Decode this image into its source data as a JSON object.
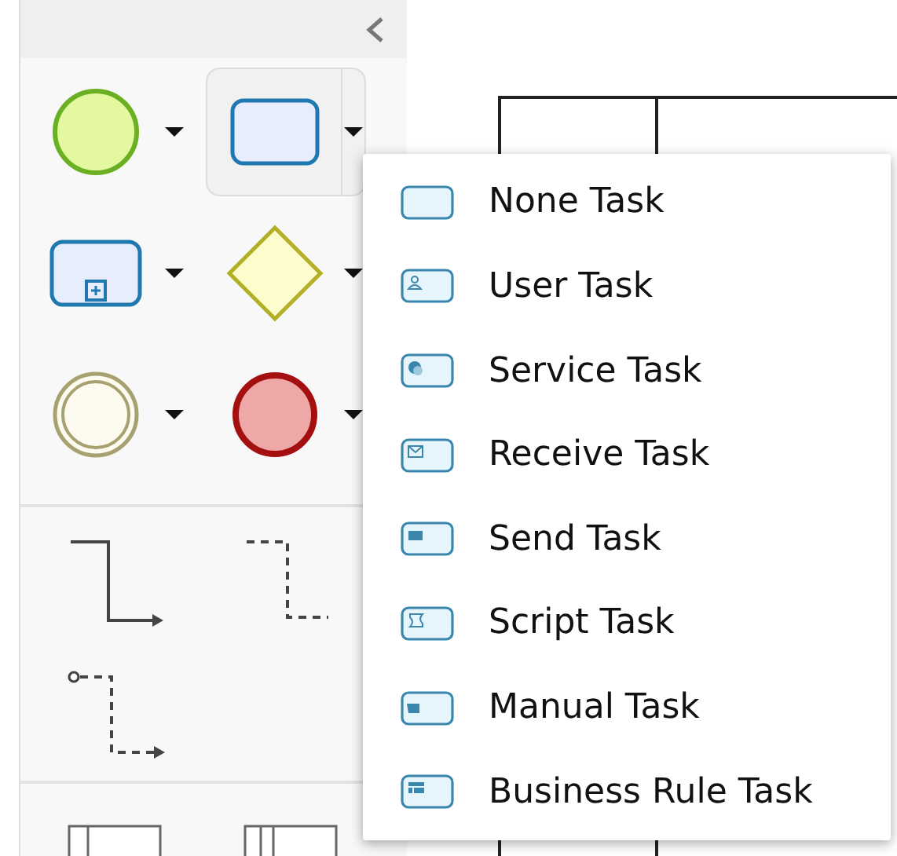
{
  "palette": {
    "collapsed": false,
    "tools": [
      {
        "kind": "start-event",
        "selected": false
      },
      {
        "kind": "task",
        "selected": true
      },
      {
        "kind": "subprocess",
        "selected": false
      },
      {
        "kind": "gateway",
        "selected": false
      },
      {
        "kind": "intermediate-event",
        "selected": false
      },
      {
        "kind": "end-event",
        "selected": false
      }
    ],
    "connectors": [
      {
        "kind": "sequence-flow"
      },
      {
        "kind": "association"
      },
      {
        "kind": "message-flow"
      }
    ],
    "containers": [
      {
        "kind": "pool"
      },
      {
        "kind": "lanes"
      }
    ]
  },
  "menu": {
    "items": [
      {
        "kind": "none",
        "label": "None Task"
      },
      {
        "kind": "user",
        "label": "User Task"
      },
      {
        "kind": "service",
        "label": "Service Task"
      },
      {
        "kind": "receive",
        "label": "Receive Task"
      },
      {
        "kind": "send",
        "label": "Send Task"
      },
      {
        "kind": "script",
        "label": "Script Task"
      },
      {
        "kind": "manual",
        "label": "Manual Task"
      },
      {
        "kind": "business-rule",
        "label": "Business Rule Task"
      }
    ]
  }
}
